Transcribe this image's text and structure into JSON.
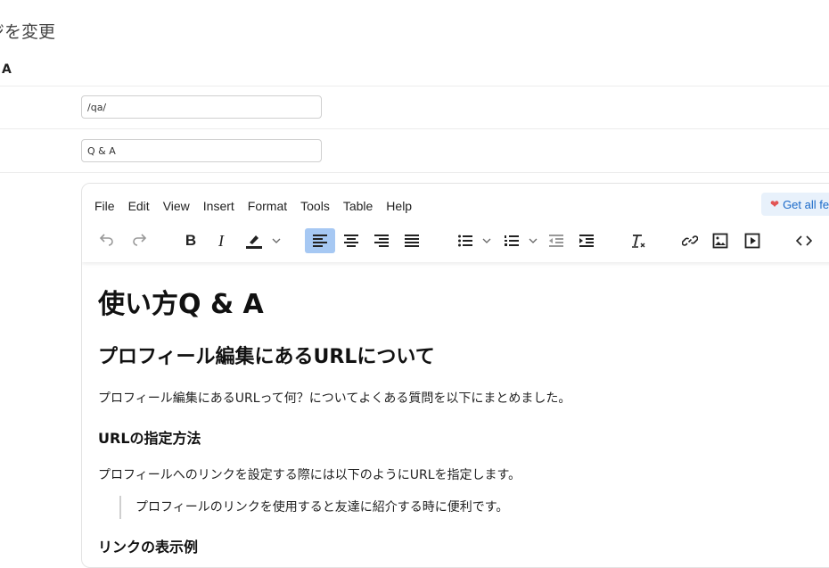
{
  "page": {
    "heading": "ジを変更",
    "section_label": "A"
  },
  "form": {
    "slug_value": "/qa/",
    "title_value": "Q & A"
  },
  "editor": {
    "menu": [
      "File",
      "Edit",
      "View",
      "Insert",
      "Format",
      "Tools",
      "Table",
      "Help"
    ],
    "promo_label": "Get all fe",
    "toolbar_icons": [
      "undo-icon",
      "redo-icon",
      "bold-icon",
      "italic-icon",
      "highlight-icon",
      "align-left-icon",
      "align-center-icon",
      "align-right-icon",
      "align-justify-icon",
      "bullet-list-icon",
      "numbered-list-icon",
      "outdent-icon",
      "indent-icon",
      "clear-format-icon",
      "link-icon",
      "image-icon",
      "media-icon",
      "code-icon"
    ],
    "active_tool": "align-left-icon",
    "colors": {
      "active": "#a6c8f3",
      "promo_bg": "#e8f1fb",
      "promo_text": "#1b6ac9"
    }
  },
  "content": {
    "h1": "使い方Q & A",
    "h2": "プロフィール編集にあるURLについて",
    "p1": "プロフィール編集にあるURLって何？についてよくある質問を以下にまとめました。",
    "h3a": "URLの指定方法",
    "p2": "プロフィールへのリンクを設定する際には以下のようにURLを指定します。",
    "quote": "プロフィールのリンクを使用すると友達に紹介する時に便利です。",
    "h3b": "リンクの表示例"
  }
}
